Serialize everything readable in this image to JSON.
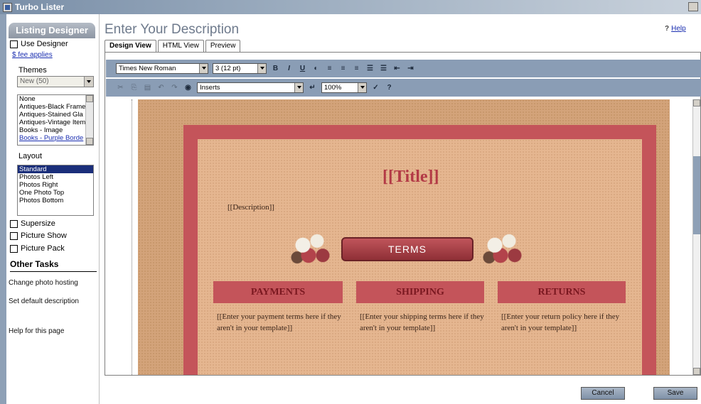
{
  "window": {
    "title": "Turbo Lister"
  },
  "sidebar": {
    "header": "Listing Designer",
    "use_designer": "Use Designer",
    "fee_link": "$ fee applies",
    "themes_label": "Themes",
    "themes_value": "New (50)",
    "themes_list": [
      "None",
      "Antiques-Black Frame",
      "Antiques-Stained Gla",
      "Antiques-Vintage Item",
      "Books - Image",
      "Books - Purple Borde"
    ],
    "layout_label": "Layout",
    "layout_list": [
      "Standard",
      "Photos Left",
      "Photos Right",
      "One Photo Top",
      "Photos Bottom"
    ],
    "checkboxes": [
      "Supersize",
      "Picture Show",
      "Picture Pack"
    ],
    "other_tasks": "Other Tasks",
    "tasks": [
      "Change photo hosting",
      "Set default description",
      "Help for this page"
    ]
  },
  "main": {
    "title": "Enter Your Description",
    "help_icon": "?",
    "help_label": "Help",
    "tabs": [
      "Design View",
      "HTML View",
      "Preview"
    ],
    "font_value": "Times New Roman",
    "size_value": "3 (12 pt)",
    "inserts_value": "Inserts",
    "zoom_value": "100%",
    "fmt_bold": "B",
    "fmt_italic": "I",
    "fmt_underline": "U",
    "help_btn": "?"
  },
  "template": {
    "title": "[[Title]]",
    "description": "[[Description]]",
    "terms_banner": "TERMS",
    "sections": [
      {
        "heading": "PAYMENTS",
        "text": "[[Enter your payment terms here if they aren't in your template]]"
      },
      {
        "heading": "SHIPPING",
        "text": "[[Enter your shipping terms here if they aren't in your template]]"
      },
      {
        "heading": "RETURNS",
        "text": "[[Enter your return policy here if they aren't in your template]]"
      }
    ]
  },
  "footer": {
    "cancel": "Cancel",
    "save": "Save"
  }
}
